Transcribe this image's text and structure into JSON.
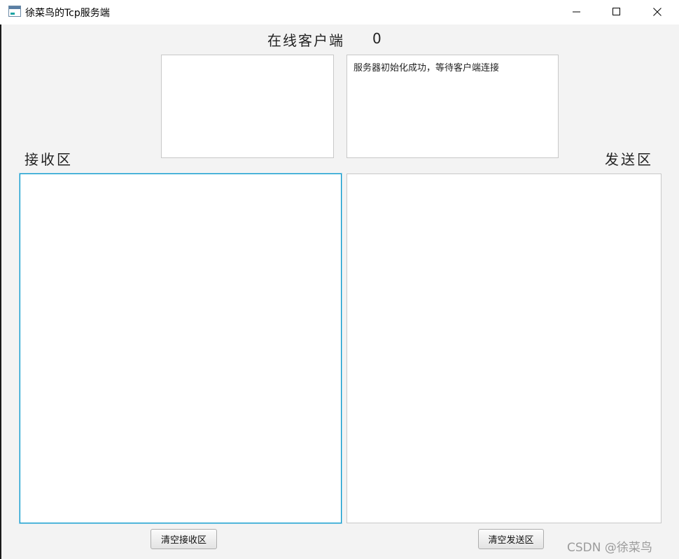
{
  "window": {
    "title": "徐菜鸟的Tcp服务端",
    "icon": "app-window-icon",
    "controls": {
      "minimize": "minimize-icon",
      "maximize": "maximize-icon",
      "close": "close-icon"
    }
  },
  "header": {
    "online_label": "在线客户端",
    "online_count": "0"
  },
  "client_list": {
    "items": []
  },
  "status": {
    "message": "服务器初始化成功，等待客户端连接"
  },
  "receive": {
    "label": "接收区",
    "content": ""
  },
  "send": {
    "label": "发送区",
    "content": ""
  },
  "buttons": {
    "clear_receive": "清空接收区",
    "clear_send": "清空发送区"
  },
  "watermark": "CSDN @徐菜鸟",
  "colors": {
    "focus_border": "#0096c9",
    "background": "#f3f3f3"
  }
}
